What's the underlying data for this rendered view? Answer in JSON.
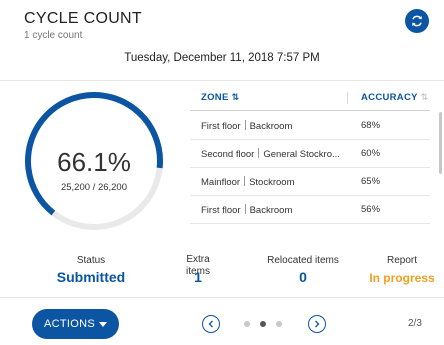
{
  "header": {
    "title": "CYCLE COUNT",
    "subtitle": "1 cycle count",
    "datetime": "Tuesday, December 11, 2018 7:57 PM"
  },
  "gauge": {
    "percent_text": "66.1%",
    "counts_text": "25,200 / 26,200",
    "fraction": 0.661,
    "color": "#0b55a3",
    "track_color": "#e9e9e9"
  },
  "table": {
    "columns": [
      "ZONE",
      "ACCURACY"
    ],
    "rows": [
      {
        "zone_a": "First floor",
        "zone_b": "Backroom",
        "accuracy": "68%"
      },
      {
        "zone_a": "Second floor",
        "zone_b": "General Stockro...",
        "accuracy": "60%"
      },
      {
        "zone_a": "Mainfloor",
        "zone_b": "Stockroom",
        "accuracy": "65%"
      },
      {
        "zone_a": "First floor",
        "zone_b": "Backroom",
        "accuracy": "56%"
      }
    ]
  },
  "stats": {
    "status_label": "Status",
    "status_value": "Submitted",
    "extra_label": "Extra items",
    "extra_value": "1",
    "relocated_label": "Relocated items",
    "relocated_value": "0",
    "report_label": "Report",
    "report_value": "In progress"
  },
  "footer": {
    "actions_label": "ACTIONS",
    "page_indicator": "2/3",
    "current_page": 2,
    "total_pages": 3
  },
  "colors": {
    "brand_blue": "#0b55a3",
    "progress_orange": "#f0a020"
  },
  "icons": [
    "refresh-icon",
    "sort-icon",
    "chevron-left-icon",
    "chevron-right-icon",
    "caret-down-icon"
  ]
}
